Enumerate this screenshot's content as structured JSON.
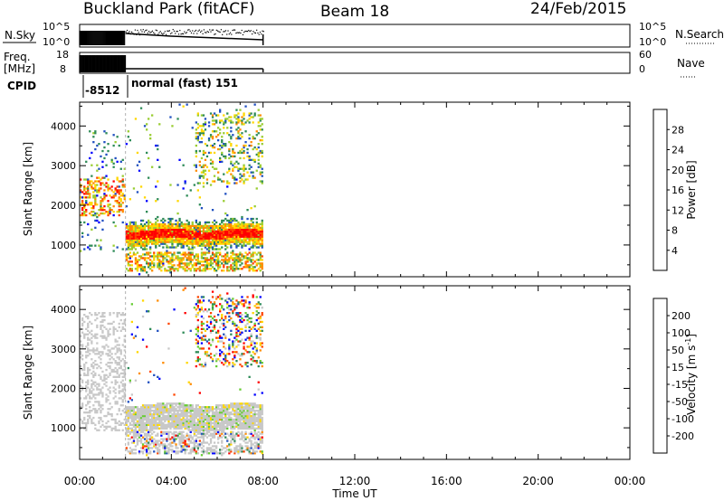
{
  "header": {
    "station": "Buckland Park (fitACF)",
    "beam": "Beam 18",
    "date": "24/Feb/2015"
  },
  "strips": {
    "nsky_label": "N.Sky",
    "nsky_ticks": [
      "10^5",
      "10^0"
    ],
    "nsearch_ticks": [
      "10^5",
      "10^0"
    ],
    "nsearch_label": "N.Search",
    "freq_label": "Freq.",
    "freq_unit": "[MHz]",
    "freq_ticks": [
      "18",
      "8"
    ],
    "nave_ticks": [
      "60",
      "0"
    ],
    "nave_label": "Nave",
    "cpid_label": "CPID",
    "cpid_values": [
      "-8512",
      "normal (fast) 151"
    ]
  },
  "colors": {
    "power": [
      "#0000ff",
      "#2050c0",
      "#2e8b57",
      "#9acd32",
      "#ffd700",
      "#ff8c00",
      "#ff4500",
      "#ff0000"
    ],
    "velocity": [
      "#ff0000",
      "#ff4500",
      "#ff8c00",
      "#ffd700",
      "#c8c8c8",
      "#66cc33",
      "#2e8b57",
      "#2050c0",
      "#0000ff"
    ]
  },
  "chart_data": [
    {
      "type": "heatmap",
      "name": "power",
      "xlabel": "",
      "ylabel": "Slant Range [km]",
      "x_ticks": [
        "00:00",
        "04:00",
        "08:00",
        "12:00",
        "16:00",
        "20:00",
        "00:00"
      ],
      "xlim_hours": [
        0,
        24
      ],
      "ylim": [
        200,
        4600
      ],
      "y_ticks": [
        1000,
        2000,
        3000,
        4000
      ],
      "colorbar_label": "Power [dB]",
      "colorbar_ticks": [
        "4",
        "8",
        "12",
        "16",
        "20",
        "24",
        "28"
      ],
      "data_extent_hours": [
        0,
        8
      ],
      "mode_change_hour": 2
    },
    {
      "type": "heatmap",
      "name": "velocity",
      "xlabel": "Time UT",
      "ylabel": "Slant Range [km]",
      "x_ticks": [
        "00:00",
        "04:00",
        "08:00",
        "12:00",
        "16:00",
        "20:00",
        "00:00"
      ],
      "xlim_hours": [
        0,
        24
      ],
      "ylim": [
        200,
        4600
      ],
      "y_ticks": [
        1000,
        2000,
        3000,
        4000
      ],
      "colorbar_label": "Velocity [m s",
      "colorbar_label_sup": "-1",
      "colorbar_label_end": "]",
      "colorbar_ticks": [
        "-200",
        "-100",
        "-50",
        "-15",
        "15",
        "50",
        "100",
        "200"
      ],
      "data_extent_hours": [
        0,
        8
      ],
      "mode_change_hour": 2
    }
  ]
}
